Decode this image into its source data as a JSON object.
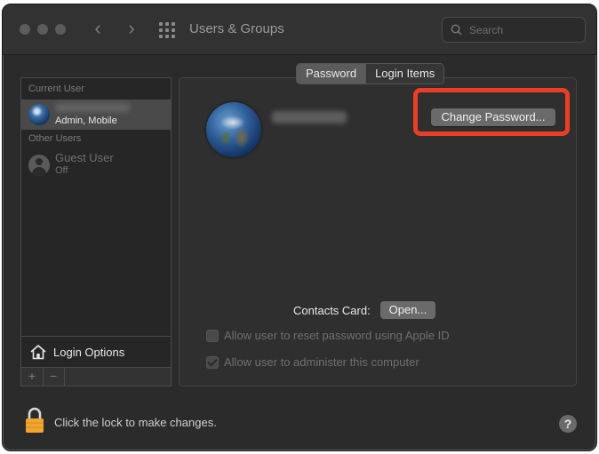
{
  "window": {
    "title": "Users & Groups",
    "search": {
      "placeholder": "Search",
      "value": ""
    }
  },
  "sidebar": {
    "current_user_header": "Current User",
    "current_user": {
      "role": "Admin, Mobile",
      "avatar_icon": "earth-globe-avatar"
    },
    "other_users_header": "Other Users",
    "other_users": [
      {
        "name": "Guest User",
        "status": "Off",
        "avatar_icon": "person-silhouette-icon"
      }
    ],
    "login_options_label": "Login Options",
    "add_symbol": "+",
    "remove_symbol": "−"
  },
  "main": {
    "tabs": [
      {
        "label": "Password",
        "selected": true
      },
      {
        "label": "Login Items",
        "selected": false
      }
    ],
    "change_password_label": "Change Password...",
    "contacts_card_label": "Contacts Card:",
    "open_button_label": "Open...",
    "options": [
      {
        "label": "Allow user to reset password using Apple ID",
        "checked": false,
        "enabled": false
      },
      {
        "label": "Allow user to administer this computer",
        "checked": true,
        "enabled": false
      }
    ]
  },
  "footer": {
    "lock_text": "Click the lock to make changes.",
    "help_symbol": "?"
  },
  "colors": {
    "window_bg": "#2b2b2b",
    "highlight": "#ea3f25",
    "lock": "#f0a62f"
  }
}
